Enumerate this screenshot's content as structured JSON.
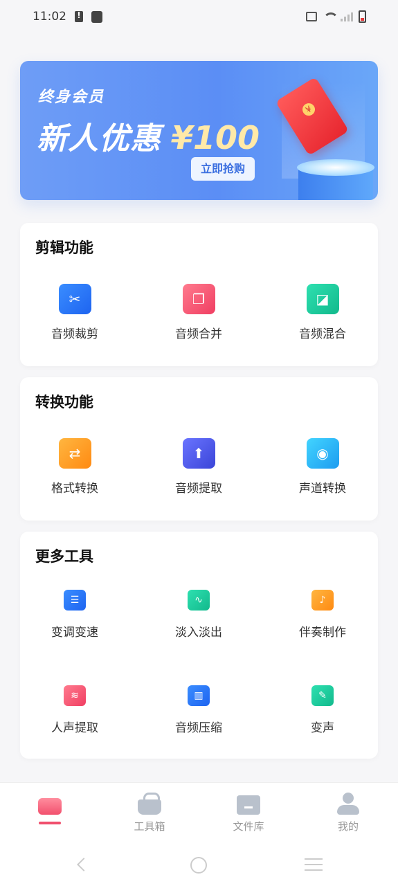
{
  "status_bar": {
    "time": "11:02"
  },
  "banner": {
    "tag": "终身会员",
    "headline": "新人优惠",
    "price": "¥100",
    "button": "立即抢购"
  },
  "sections": {
    "edit": {
      "title": "剪辑功能",
      "items": [
        {
          "label": "音频裁剪",
          "icon": "scissors-icon",
          "color": "#1e74ff"
        },
        {
          "label": "音频合并",
          "icon": "merge-icon",
          "color": "#f54b6a"
        },
        {
          "label": "音频混合",
          "icon": "mix-icon",
          "color": "#19c99b"
        }
      ]
    },
    "convert": {
      "title": "转换功能",
      "items": [
        {
          "label": "格式转换",
          "icon": "format-convert-icon",
          "color": "#ffa21f"
        },
        {
          "label": "音频提取",
          "icon": "extract-icon",
          "color": "#4d5bf0"
        },
        {
          "label": "声道转换",
          "icon": "channel-icon",
          "color": "#1fb6f5"
        }
      ]
    },
    "more": {
      "title": "更多工具",
      "items": [
        {
          "label": "变调变速",
          "icon": "sliders-icon",
          "color": "#1e74ff"
        },
        {
          "label": "淡入淡出",
          "icon": "waveform-icon",
          "color": "#19c99b"
        },
        {
          "label": "伴奏制作",
          "icon": "music-note-icon",
          "color": "#ffa21f"
        },
        {
          "label": "人声提取",
          "icon": "voice-icon",
          "color": "#f54b6a"
        },
        {
          "label": "音频压缩",
          "icon": "zip-icon",
          "color": "#1e74ff"
        },
        {
          "label": "变声",
          "icon": "voice-change-icon",
          "color": "#19c99b"
        }
      ]
    }
  },
  "bottom_nav": {
    "active_color": "#f04f6d",
    "items": [
      {
        "label": "",
        "icon": "home-icon"
      },
      {
        "label": "工具箱",
        "icon": "toolbox-icon"
      },
      {
        "label": "文件库",
        "icon": "folder-icon"
      },
      {
        "label": "我的",
        "icon": "user-icon"
      }
    ]
  }
}
